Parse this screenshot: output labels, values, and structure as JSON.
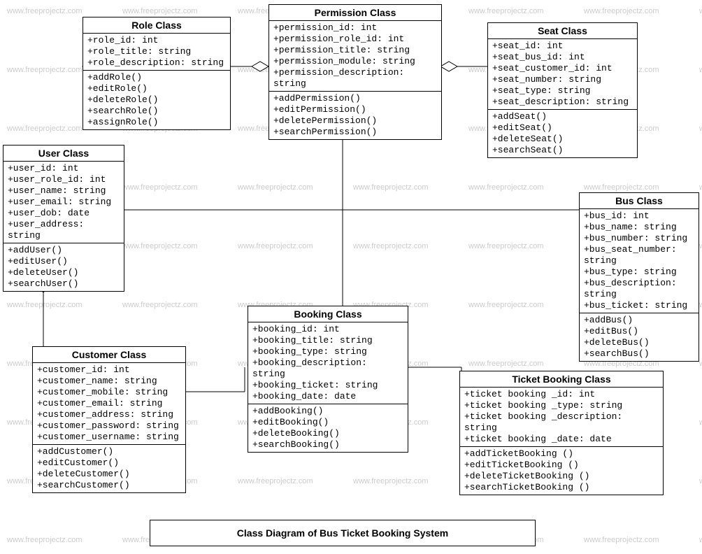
{
  "diagram_title": "Class Diagram of Bus Ticket Booking System",
  "watermark_text": "www.freeprojectz.com",
  "classes": {
    "role": {
      "title": "Role Class",
      "attrs": [
        "+role_id: int",
        "+role_title: string",
        "+role_description: string"
      ],
      "methods": [
        "+addRole()",
        "+editRole()",
        "+deleteRole()",
        "+searchRole()",
        "+assignRole()"
      ]
    },
    "permission": {
      "title": "Permission Class",
      "attrs": [
        "+permission_id: int",
        "+permission_role_id: int",
        "+permission_title: string",
        "+permission_module: string",
        "+permission_description: string"
      ],
      "methods": [
        "+addPermission()",
        "+editPermission()",
        "+deletePermission()",
        "+searchPermission()"
      ]
    },
    "seat": {
      "title": "Seat Class",
      "attrs": [
        "+seat_id: int",
        "+seat_bus_id: int",
        "+seat_customer_id: int",
        "+seat_number: string",
        "+seat_type: string",
        "+seat_description: string"
      ],
      "methods": [
        "+addSeat()",
        "+editSeat()",
        "+deleteSeat()",
        "+searchSeat()"
      ]
    },
    "user": {
      "title": "User Class",
      "attrs": [
        "+user_id: int",
        "+user_role_id: int",
        "+user_name: string",
        "+user_email: string",
        "+user_dob: date",
        "+user_address: string"
      ],
      "methods": [
        "+addUser()",
        "+editUser()",
        "+deleteUser()",
        "+searchUser()"
      ]
    },
    "bus": {
      "title": "Bus Class",
      "attrs": [
        "+bus_id: int",
        "+bus_name: string",
        "+bus_number: string",
        "+bus_seat_number: string",
        "+bus_type: string",
        "+bus_description: string",
        "+bus_ticket: string"
      ],
      "methods": [
        "+addBus()",
        "+editBus()",
        "+deleteBus()",
        "+searchBus()"
      ]
    },
    "customer": {
      "title": "Customer Class",
      "attrs": [
        "+customer_id: int",
        "+customer_name: string",
        "+customer_mobile: string",
        "+customer_email: string",
        "+customer_address: string",
        "+customer_password: string",
        "+customer_username: string"
      ],
      "methods": [
        "+addCustomer()",
        "+editCustomer()",
        "+deleteCustomer()",
        "+searchCustomer()"
      ]
    },
    "booking": {
      "title": "Booking Class",
      "attrs": [
        "+booking_id: int",
        "+booking_title: string",
        "+booking_type: string",
        "+booking_description: string",
        "+booking_ticket: string",
        "+booking_date: date"
      ],
      "methods": [
        "+addBooking()",
        "+editBooking()",
        "+deleteBooking()",
        "+searchBooking()"
      ]
    },
    "ticket": {
      "title": "Ticket Booking Class",
      "attrs": [
        "+ticket booking _id: int",
        "+ticket booking _type: string",
        "+ticket booking _description: string",
        "+ticket booking _date: date"
      ],
      "methods": [
        "+addTicketBooking ()",
        "+editTicketBooking ()",
        "+deleteTicketBooking ()",
        "+searchTicketBooking ()"
      ]
    }
  }
}
